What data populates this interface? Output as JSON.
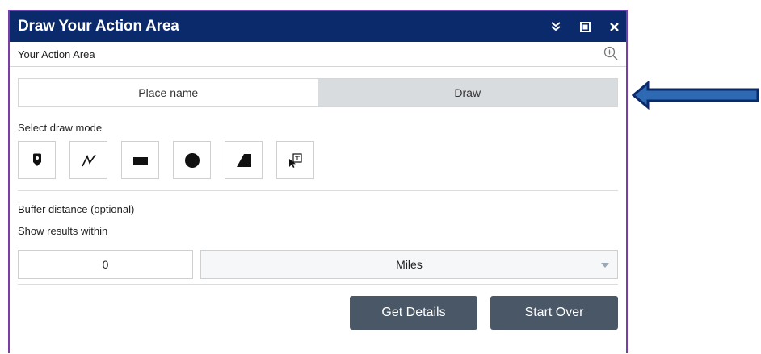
{
  "window": {
    "title": "Draw Your Action Area",
    "controls": [
      "collapse-icon",
      "maximize-icon",
      "close-icon"
    ]
  },
  "subheader": {
    "text": "Your Action Area",
    "icon": "zoom-in-icon"
  },
  "tabs": [
    {
      "label": "Place name",
      "active": true
    },
    {
      "label": "Draw",
      "active": false
    }
  ],
  "draw_mode": {
    "label": "Select draw mode",
    "tools": [
      "point-icon",
      "polyline-icon",
      "rectangle-icon",
      "circle-icon",
      "polygon-icon",
      "select-features-icon"
    ]
  },
  "buffer": {
    "label": "Buffer distance (optional)",
    "sublabel": "Show results within",
    "distance_value": "0",
    "unit_selected": "Miles"
  },
  "actions": {
    "get_details": "Get Details",
    "start_over": "Start Over"
  },
  "colors": {
    "titlebar": "#0b2a6b",
    "panel_border": "#7a3fa7",
    "button": "#4a5766",
    "arrow": "#0b2a6b"
  }
}
